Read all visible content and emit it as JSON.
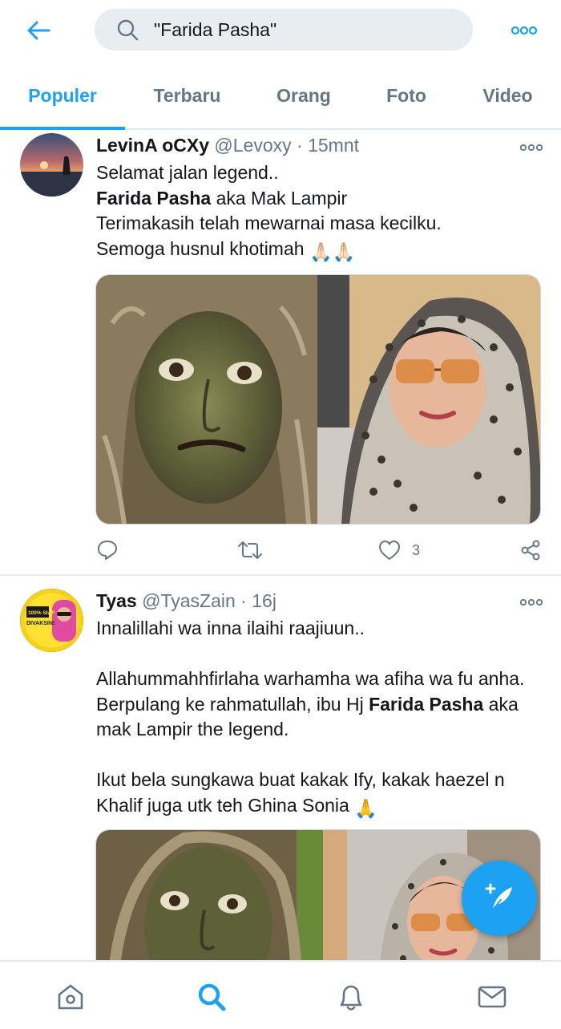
{
  "search": {
    "query": "\"Farida Pasha\""
  },
  "tabs": [
    {
      "label": "Populer",
      "active": true
    },
    {
      "label": "Terbaru",
      "active": false
    },
    {
      "label": "Orang",
      "active": false
    },
    {
      "label": "Foto",
      "active": false
    },
    {
      "label": "Video",
      "active": false
    }
  ],
  "tweets": [
    {
      "name": "LevinA oCXy",
      "handle": "@Levoxy",
      "separator": "·",
      "time": "15mnt",
      "lines": [
        "Selamat jalan legend..",
        {
          "bold": "Farida Pasha",
          "rest": " aka Mak Lampir"
        },
        "Terimakasih telah mewarnai masa kecilku.",
        "Semoga husnul khotimah"
      ],
      "emoji": "🙏🏻🙏🏻",
      "actions": {
        "like_count": "3"
      }
    },
    {
      "name": "Tyas",
      "handle": "@TyasZain",
      "separator": "·",
      "time": "16j",
      "line1": "Innalillahi wa inna ilaihi raajiuun..",
      "line2": "Allahummahhfirlaha warhamha wa afiha wa fu anha.",
      "line3_pre": "Berpulang ke rahmatullah, ibu Hj ",
      "line3_bold": "Farida Pasha",
      "line3_post": " aka",
      "line4": "mak Lampir the legend.",
      "line5": "Ikut bela sungkawa buat kakak Ify, kakak haezel n",
      "line6": "Khalif juga utk teh Ghina Sonia",
      "emoji": "🙏",
      "avatar_text": [
        "100% SIAP",
        "DIVAKSIN!"
      ]
    }
  ],
  "icons": {
    "back": "arrow-left-icon",
    "search": "search-icon",
    "more": "more-horizontal-icon",
    "reply": "reply-icon",
    "retweet": "retweet-icon",
    "like": "heart-icon",
    "share": "share-icon",
    "compose": "compose-tweet-icon",
    "home": "home-icon",
    "explore": "search-icon",
    "notifications": "bell-icon",
    "messages": "mail-icon"
  },
  "colors": {
    "accent": "#1da1f2",
    "text": "#14171a",
    "muted": "#657786",
    "search_bg": "#e8edf1"
  }
}
